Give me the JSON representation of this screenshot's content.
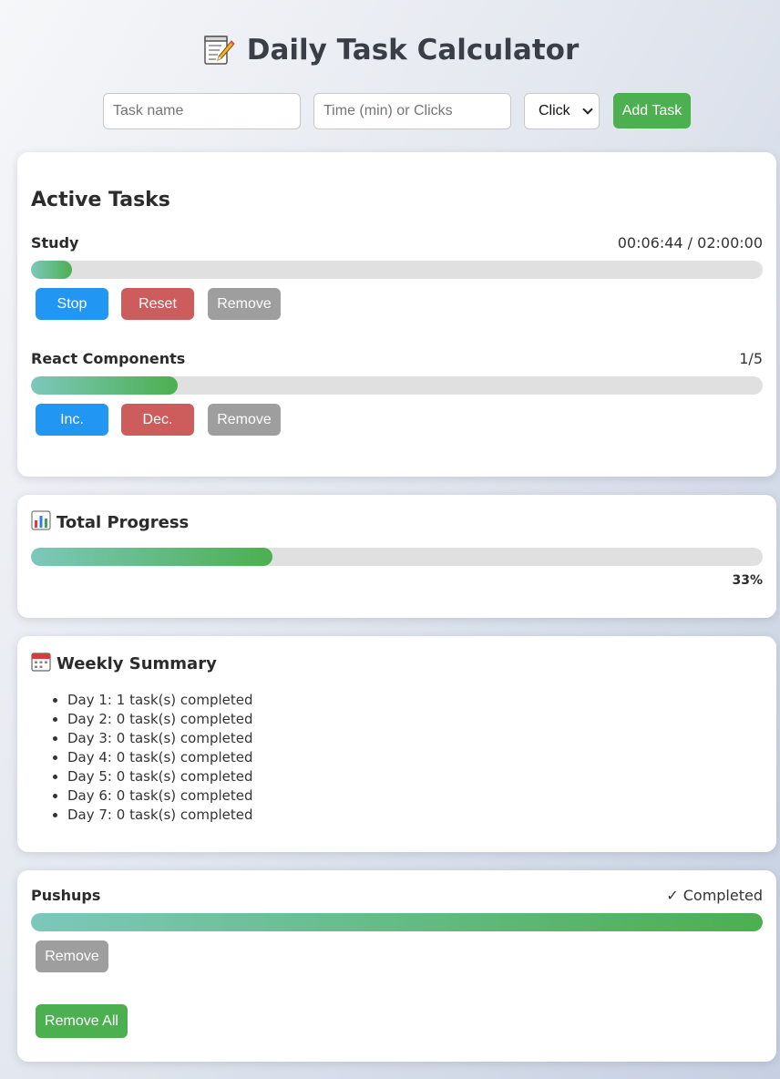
{
  "app": {
    "title": "Daily Task Calculator",
    "title_icon": "memo-icon"
  },
  "form": {
    "task_name_placeholder": "Task name",
    "task_amount_placeholder": "Time (min) or Clicks",
    "type_selected": "Click",
    "add_label": "Add Task"
  },
  "active": {
    "heading": "Active Tasks",
    "tasks": [
      {
        "name": "Study",
        "status": "00:06:44 / 02:00:00",
        "progress": 0.056,
        "buttons": [
          "Stop",
          "Reset",
          "Remove"
        ]
      },
      {
        "name": "React Components",
        "status": "1/5",
        "progress": 0.2,
        "buttons": [
          "Inc.",
          "Dec.",
          "Remove"
        ]
      }
    ]
  },
  "total": {
    "icon": "bar-chart-icon",
    "heading": "Total Progress",
    "percent_label": "33%",
    "progress": 0.33
  },
  "weekly": {
    "icon": "calendar-icon",
    "heading": "Weekly Summary",
    "days": [
      "Day 1: 1 task(s) completed",
      "Day 2: 0 task(s) completed",
      "Day 3: 0 task(s) completed",
      "Day 4: 0 task(s) completed",
      "Day 5: 0 task(s) completed",
      "Day 6: 0 task(s) completed",
      "Day 7: 0 task(s) completed"
    ]
  },
  "completed": {
    "task": {
      "name": "Pushups",
      "status": "✓ Completed",
      "progress": 1.0,
      "remove_label": "Remove"
    },
    "remove_all_label": "Remove All"
  },
  "colors": {
    "green": "#4caf50",
    "blue": "#2196f3",
    "red": "#cd5c5c",
    "grey": "#9e9e9e",
    "track": "#e0e0e0",
    "fill_start": "#7cc8bb"
  }
}
